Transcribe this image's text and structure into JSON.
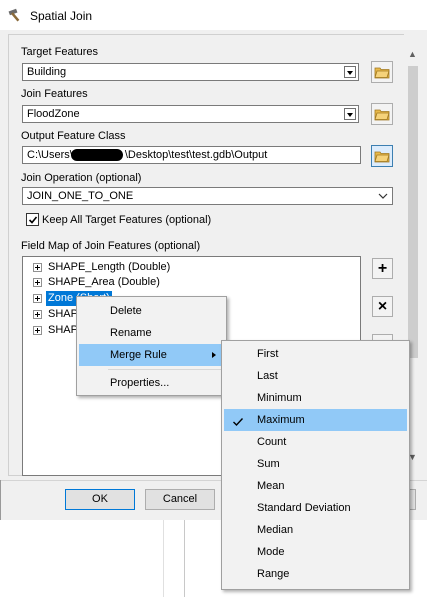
{
  "window": {
    "title": "Spatial Join"
  },
  "form": {
    "target_features_label": "Target Features",
    "target_features_value": "Building",
    "join_features_label": "Join Features",
    "join_features_value": "FloodZone",
    "output_label": "Output Feature Class",
    "output_value_prefix": "C:\\Users\\",
    "output_value_suffix": "\\Desktop\\test\\test.gdb\\Output",
    "join_operation_label": "Join Operation (optional)",
    "join_operation_value": "JOIN_ONE_TO_ONE",
    "keep_all_label": "Keep All Target Features (optional)",
    "keep_all_checked": true,
    "field_map_label": "Field Map of Join Features (optional)"
  },
  "field_map": {
    "fields": [
      {
        "label": "SHAPE_Length (Double)"
      },
      {
        "label": "SHAPE_Area (Double)"
      },
      {
        "label": "Zone (Short)"
      },
      {
        "label": "SHAPE"
      },
      {
        "label": "SHAPE"
      }
    ],
    "selected_index": 2
  },
  "side_buttons": {
    "add": "+",
    "remove": "×"
  },
  "footer": {
    "ok": "OK",
    "cancel": "Cancel"
  },
  "context_menu": {
    "items": [
      "Delete",
      "Rename",
      "Merge Rule",
      "Properties..."
    ],
    "hot_index": 2
  },
  "merge_rule_menu": {
    "items": [
      "First",
      "Last",
      "Minimum",
      "Maximum",
      "Count",
      "Sum",
      "Mean",
      "Standard Deviation",
      "Median",
      "Mode",
      "Range"
    ],
    "checked_index": 3
  },
  "colors": {
    "accent": "#0078d7",
    "menu_hot": "#91c9f7",
    "dialog_bg": "#f0f0f0"
  }
}
